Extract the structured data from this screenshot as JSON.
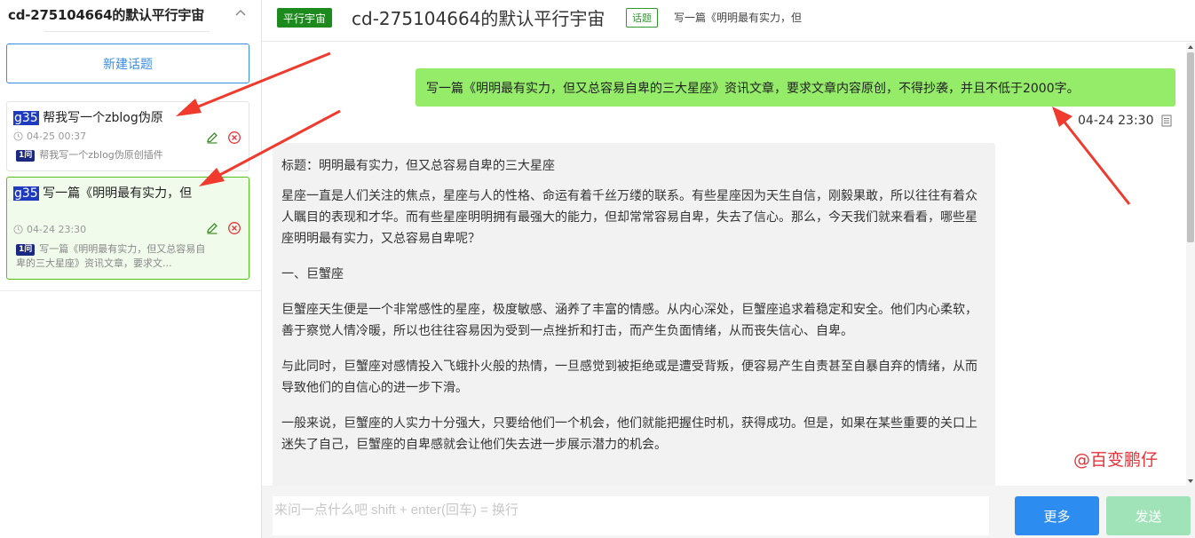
{
  "sidebar": {
    "title": "cd-275104664的默认平行宇宙",
    "new_topic_label": "新建话题",
    "conversations": [
      {
        "tag": "g35",
        "title": " 帮我写一个zblog伪原",
        "time": "04-25 00:37",
        "count": "1问",
        "preview": "帮我写一个zblog伪原创插件"
      },
      {
        "tag": "g35",
        "title": " 写一篇《明明最有实力，但",
        "time": "04-24 23:30",
        "count": "1问",
        "preview": "写一篇《明明最有实力，但又总容易自卑的三大星座》资讯文章，要求文..."
      }
    ]
  },
  "header": {
    "universe_badge": "平行宇宙",
    "title": "cd-275104664的默认平行宇宙",
    "topic_badge": "话题",
    "subtitle": "写一篇《明明最有实力，但"
  },
  "chat": {
    "user_message": "写一篇《明明最有实力，但又总容易自卑的三大星座》资讯文章，要求文章内容原创，不得抄袭，并且不低于2000字。",
    "user_time": "04-24 23:30",
    "bot_paragraphs": [
      "标题：明明最有实力，但又总容易自卑的三大星座",
      "星座一直是人们关注的焦点，星座与人的性格、命运有着千丝万缕的联系。有些星座因为天生自信，刚毅果敢，所以往往有着众人瞩目的表现和才华。而有些星座明明拥有最强大的能力，但却常常容易自卑，失去了信心。那么，今天我们就来看看，哪些星座明明最有实力，又总容易自卑呢？",
      "一、巨蟹座",
      "巨蟹座天生便是一个非常感性的星座，极度敏感、涵养了丰富的情感。从内心深处，巨蟹座追求着稳定和安全。他们内心柔软，善于察觉人情冷暖，所以也往往容易因为受到一点挫折和打击，而产生负面情绪，从而丧失信心、自卑。",
      "与此同时，巨蟹座对感情投入飞蛾扑火般的热情，一旦感觉到被拒绝或是遭受背叛，便容易产生自责甚至自暴自弃的情绪，从而导致他们的自信心的进一步下滑。",
      "一般来说，巨蟹座的人实力十分强大，只要给他们一个机会，他们就能把握住时机，获得成功。但是，如果在某些重要的关口上迷失了自己，巨蟹座的自卑感就会让他们失去进一步展示潜力的机会。"
    ]
  },
  "watermark": "@百变鹏仔",
  "input": {
    "placeholder": "来问一点什么吧 shift + enter(回车) = 换行",
    "value": ""
  },
  "buttons": {
    "more": "更多",
    "send": "发送"
  },
  "colors": {
    "accent_blue": "#2d8cf0",
    "user_bubble": "#95ec69",
    "universe_green": "#1c8a1c",
    "active_item_border": "#52c41a",
    "delete_red": "#e5343a",
    "annotation_arrow": "#f03a2e",
    "send_disabled": "#a0e3b8"
  }
}
